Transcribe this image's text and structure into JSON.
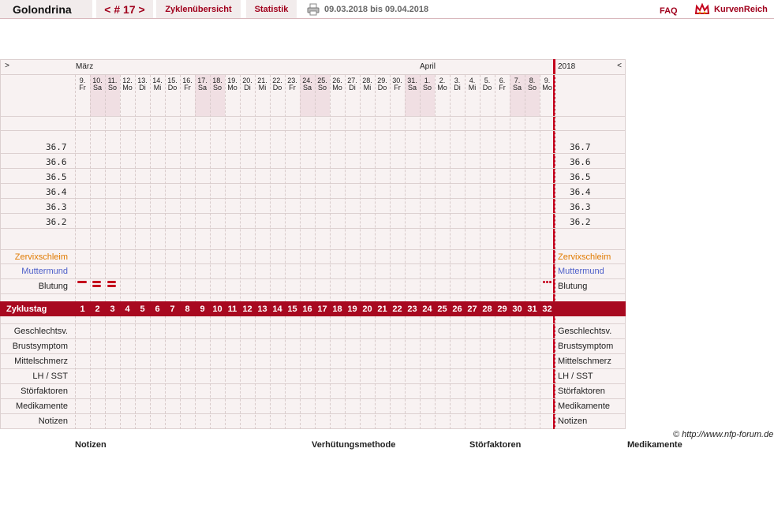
{
  "header": {
    "app_name": "Golondrina",
    "cycle_nav": "< # 17 >",
    "nav_cycles": "Zyklenübersicht",
    "nav_stats": "Statistik",
    "date_range": "09.03.2018 bis 09.04.2018",
    "faq": "FAQ",
    "brand": "KurvenReich",
    "printer_icon": "printer-icon",
    "brand_icon": "crown-icon"
  },
  "chart": {
    "scroll_left": ">",
    "scroll_right": "<",
    "month1": "März",
    "month2": "April",
    "year": "2018",
    "days": [
      {
        "d": "9.",
        "w": "Fr"
      },
      {
        "d": "10.",
        "w": "Sa"
      },
      {
        "d": "11.",
        "w": "So"
      },
      {
        "d": "12.",
        "w": "Mo"
      },
      {
        "d": "13.",
        "w": "Di"
      },
      {
        "d": "14.",
        "w": "Mi"
      },
      {
        "d": "15.",
        "w": "Do"
      },
      {
        "d": "16.",
        "w": "Fr"
      },
      {
        "d": "17.",
        "w": "Sa"
      },
      {
        "d": "18.",
        "w": "So"
      },
      {
        "d": "19.",
        "w": "Mo"
      },
      {
        "d": "20.",
        "w": "Di"
      },
      {
        "d": "21.",
        "w": "Mi"
      },
      {
        "d": "22.",
        "w": "Do"
      },
      {
        "d": "23.",
        "w": "Fr"
      },
      {
        "d": "24.",
        "w": "Sa"
      },
      {
        "d": "25.",
        "w": "So"
      },
      {
        "d": "26.",
        "w": "Mo"
      },
      {
        "d": "27.",
        "w": "Di"
      },
      {
        "d": "28.",
        "w": "Mi"
      },
      {
        "d": "29.",
        "w": "Do"
      },
      {
        "d": "30.",
        "w": "Fr"
      },
      {
        "d": "31.",
        "w": "Sa"
      },
      {
        "d": "1.",
        "w": "So"
      },
      {
        "d": "2.",
        "w": "Mo"
      },
      {
        "d": "3.",
        "w": "Di"
      },
      {
        "d": "4.",
        "w": "Mi"
      },
      {
        "d": "5.",
        "w": "Do"
      },
      {
        "d": "6.",
        "w": "Fr"
      },
      {
        "d": "7.",
        "w": "Sa"
      },
      {
        "d": "8.",
        "w": "So"
      },
      {
        "d": "9.",
        "w": "Mo"
      }
    ],
    "temp_labels": [
      "36.7",
      "36.6",
      "36.5",
      "36.4",
      "36.3",
      "36.2"
    ],
    "rows_top": [
      {
        "label": "Zervixschleim",
        "color": "#e07a00"
      },
      {
        "label": "Muttermund",
        "color": "#4d5fc9"
      },
      {
        "label": "Blutung",
        "color": "#222222"
      }
    ],
    "cycle_day_label": "Zyklustag",
    "cycle_days": [
      "1",
      "2",
      "3",
      "4",
      "5",
      "6",
      "7",
      "8",
      "9",
      "10",
      "11",
      "12",
      "13",
      "14",
      "15",
      "16",
      "17",
      "18",
      "19",
      "20",
      "21",
      "22",
      "23",
      "24",
      "25",
      "26",
      "27",
      "28",
      "29",
      "30",
      "31",
      "32"
    ],
    "rows_bottom": [
      "Geschlechtsv.",
      "Brustsymptom",
      "Mittelschmerz",
      "LH / SST",
      "Störfaktoren",
      "Medikamente",
      "Notizen"
    ],
    "bleeding_days": [
      1,
      2,
      3
    ],
    "spotting_day": 32,
    "colors": {
      "accent": "#a80920",
      "weekend": "#f0dfe3",
      "grid": "#dcd0d0",
      "panel": "#f8f2f2"
    }
  },
  "copyright": "© http://www.nfp-forum.de",
  "footer": {
    "notes": "Notizen",
    "method": "Verhütungsmethode",
    "disturbances": "Störfaktoren",
    "medication": "Medikamente"
  }
}
